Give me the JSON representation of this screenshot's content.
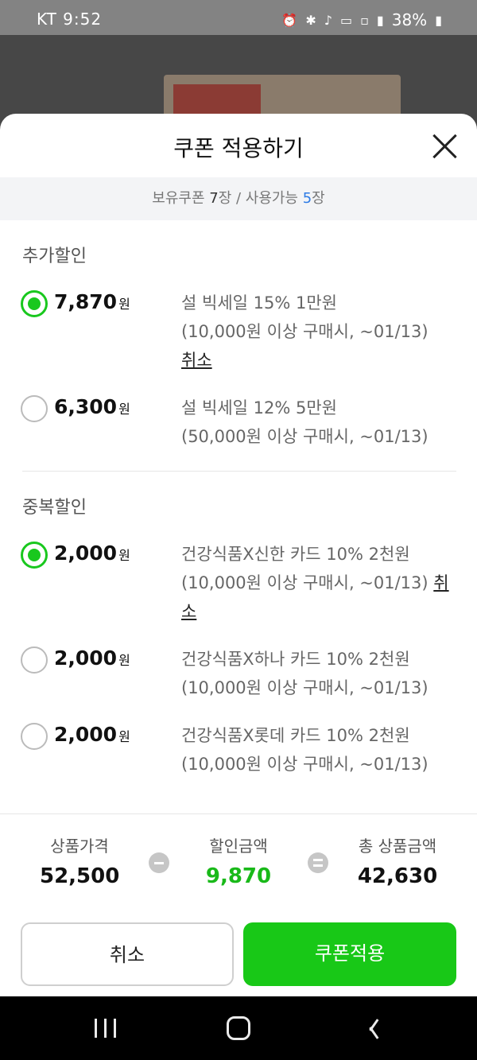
{
  "status_bar": {
    "carrier_time": "KT  9:52",
    "icons": [
      "alarm-icon",
      "bluetooth-icon",
      "mute-icon",
      "hd-icon",
      "5g-icon",
      "signal-icon"
    ],
    "battery": "38%"
  },
  "sheet": {
    "title": "쿠폰 적용하기",
    "summary": {
      "owned_label": "보유쿠폰 ",
      "owned_count": "7",
      "owned_unit": "장 / 사용가능 ",
      "usable_count": "5",
      "usable_unit": "장"
    }
  },
  "extra_discount": {
    "title": "추가할인",
    "coupons": [
      {
        "amount": "7,870",
        "unit": "원",
        "selected": true,
        "desc1": "설 빅세일 15% 1만원",
        "desc2": "(10,000원 이상 구매시, ~01/13)",
        "cancel": "취소"
      },
      {
        "amount": "6,300",
        "unit": "원",
        "selected": false,
        "desc1": "설 빅세일 12% 5만원",
        "desc2": "(50,000원 이상 구매시, ~01/13)"
      }
    ]
  },
  "stack_discount": {
    "title": "중복할인",
    "coupons": [
      {
        "amount": "2,000",
        "unit": "원",
        "selected": true,
        "desc1": "건강식품X신한 카드 10% 2천원",
        "desc2": "(10,000원 이상 구매시, ~01/13) ",
        "cancel_a": "취",
        "cancel_b": "소"
      },
      {
        "amount": "2,000",
        "unit": "원",
        "selected": false,
        "desc1": "건강식품X하나 카드 10% 2천원",
        "desc2": "(10,000원 이상 구매시, ~01/13)"
      },
      {
        "amount": "2,000",
        "unit": "원",
        "selected": false,
        "desc1": "건강식품X롯데 카드 10% 2천원",
        "desc2": "(10,000원 이상 구매시, ~01/13)"
      }
    ]
  },
  "totals": {
    "price_label": "상품가격",
    "price_value": "52,500",
    "discount_label": "할인금액",
    "discount_value": "9,870",
    "total_label": "총 상품금액",
    "total_value": "42,630"
  },
  "buttons": {
    "cancel": "취소",
    "apply": "쿠폰적용"
  },
  "colors": {
    "accent_green": "#18c817",
    "link_blue": "#2d7be5"
  }
}
